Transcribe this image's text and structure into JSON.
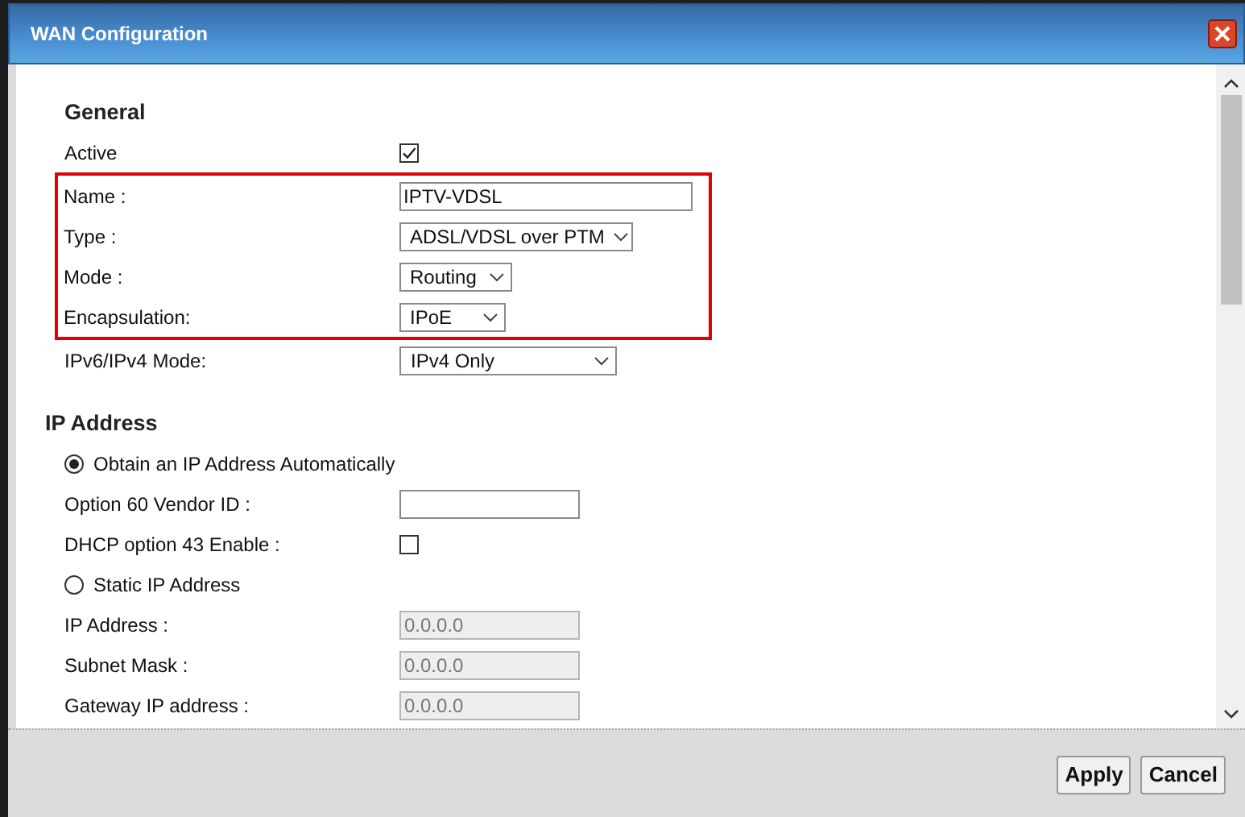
{
  "window": {
    "title": "WAN Configuration"
  },
  "sections": [
    {
      "heading": "General",
      "rows": [
        {
          "kind": "checkbox",
          "label": "Active",
          "checked": true,
          "highlighted": false
        },
        {
          "kind": "text",
          "label": "Name :",
          "value": "IPTV-VDSL",
          "disabled": false,
          "highlighted": true
        },
        {
          "kind": "select",
          "label": "Type :",
          "value": "ADSL/VDSL over PTM",
          "highlighted": true
        },
        {
          "kind": "select",
          "label": "Mode :",
          "value": "Routing",
          "highlighted": true
        },
        {
          "kind": "select",
          "label": "Encapsulation:",
          "value": "IPoE",
          "highlighted": true
        },
        {
          "kind": "select",
          "label": "IPv6/IPv4 Mode:",
          "value": "IPv4 Only",
          "highlighted": false
        }
      ]
    },
    {
      "heading": "IP Address",
      "rows": [
        {
          "kind": "radio",
          "label": "Obtain an IP Address Automatically",
          "selected": true,
          "highlighted": false
        },
        {
          "kind": "text",
          "label": "Option 60 Vendor ID :",
          "disabled": false,
          "highlighted": false
        },
        {
          "kind": "checkbox",
          "label": "DHCP option 43 Enable :",
          "checked": false,
          "highlighted": false
        },
        {
          "kind": "radio",
          "label": "Static IP Address",
          "selected": false,
          "highlighted": false
        },
        {
          "kind": "text",
          "label": "IP Address :",
          "value": "0.0.0.0",
          "disabled": true,
          "highlighted": false
        },
        {
          "kind": "text",
          "label": "Subnet Mask :",
          "value": "0.0.0.0",
          "disabled": true,
          "highlighted": false
        },
        {
          "kind": "text",
          "label": "Gateway IP address :",
          "value": "0.0.0.0",
          "disabled": true,
          "highlighted": false
        }
      ]
    }
  ],
  "buttons": [
    "Apply",
    "Cancel"
  ]
}
